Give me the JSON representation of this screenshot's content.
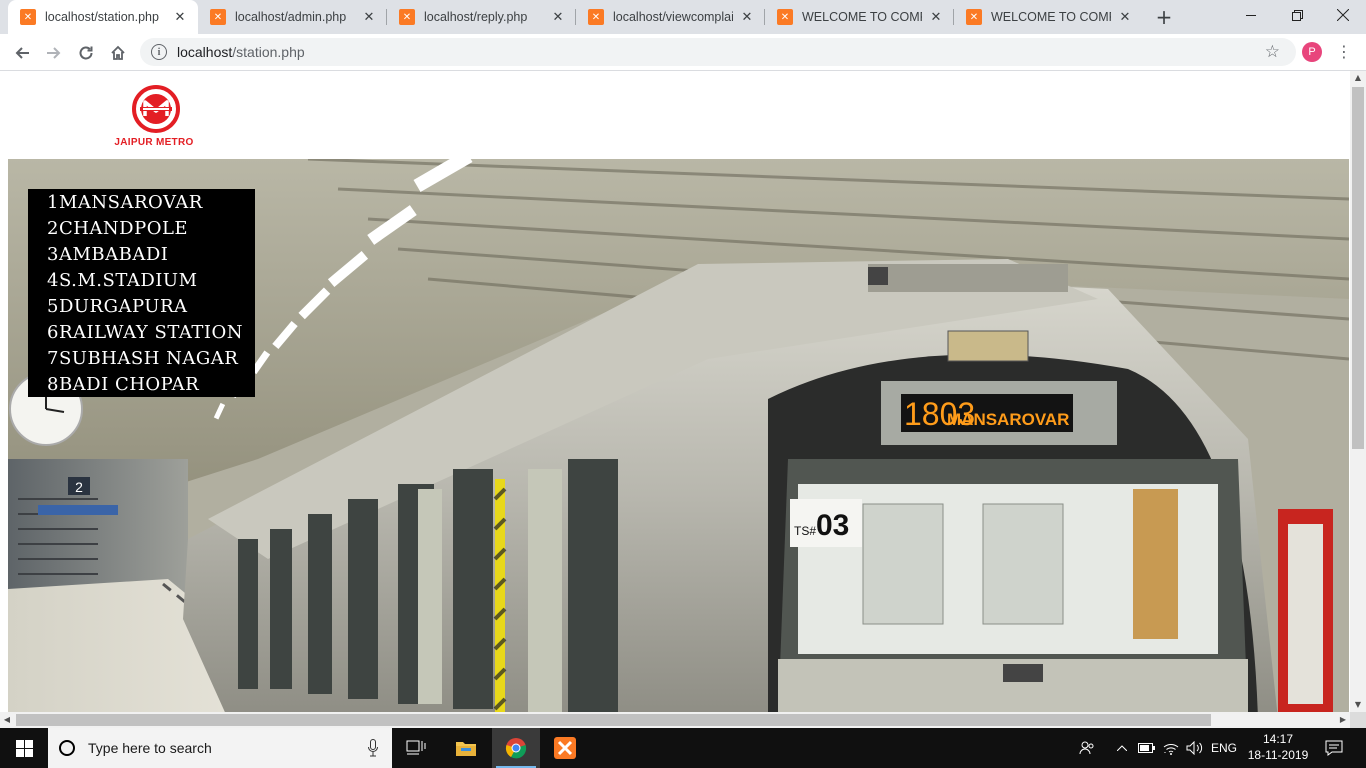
{
  "browser": {
    "tabs": [
      {
        "title": "localhost/station.php",
        "active": true
      },
      {
        "title": "localhost/admin.php",
        "active": false
      },
      {
        "title": "localhost/reply.php",
        "active": false
      },
      {
        "title": "localhost/viewcomplain",
        "active": false
      },
      {
        "title": "WELCOME TO COMPLA",
        "active": false
      },
      {
        "title": "WELCOME TO COMPLA",
        "active": false
      }
    ],
    "address": {
      "host": "localhost",
      "path": "/station.php"
    },
    "profile_initial": "P"
  },
  "page": {
    "logo_text": "JAIPUR METRO",
    "logo_color": "#e31e24",
    "stations": [
      "1MANSAROVAR",
      "2CHANDPOLE",
      "3AMBABADI",
      "4S.M.STADIUM",
      "5DURGAPURA",
      "6RAILWAY STATION",
      "7SUBHASH NAGAR",
      "8BADI CHOPAR"
    ],
    "hero": {
      "destination_number": "1803",
      "destination_name": "MANSAROVAR",
      "train_number_prefix": "TS#",
      "train_number": "03",
      "platform_number": "2"
    }
  },
  "taskbar": {
    "search_placeholder": "Type here to search",
    "language": "ENG",
    "time": "14:17",
    "date": "18-11-2019"
  }
}
